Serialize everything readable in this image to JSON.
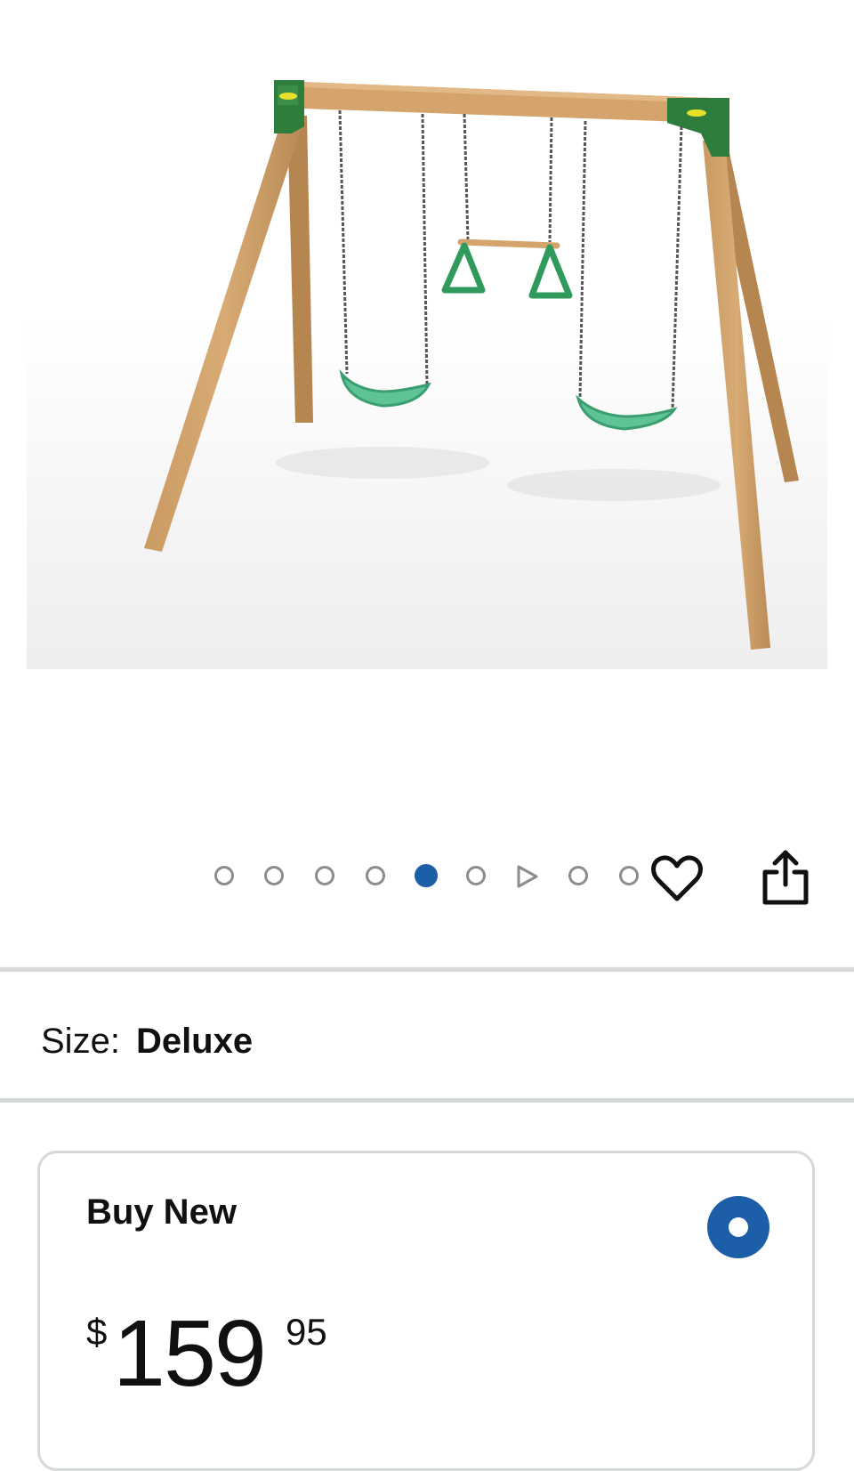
{
  "product": {
    "image_icon": "wooden-swing-set-image"
  },
  "carousel": {
    "total": 9,
    "active_index": 4,
    "video_index": 6,
    "active_color": "#1d5ea8",
    "inactive_color": "#8a8d91"
  },
  "actions": {
    "wishlist_icon": "heart-icon",
    "share_icon": "share-icon"
  },
  "size": {
    "label": "Size:",
    "value": "Deluxe"
  },
  "buy_box": {
    "title": "Buy New",
    "selected": true,
    "price": {
      "symbol": "$",
      "whole": "159",
      "fraction": "95"
    }
  }
}
